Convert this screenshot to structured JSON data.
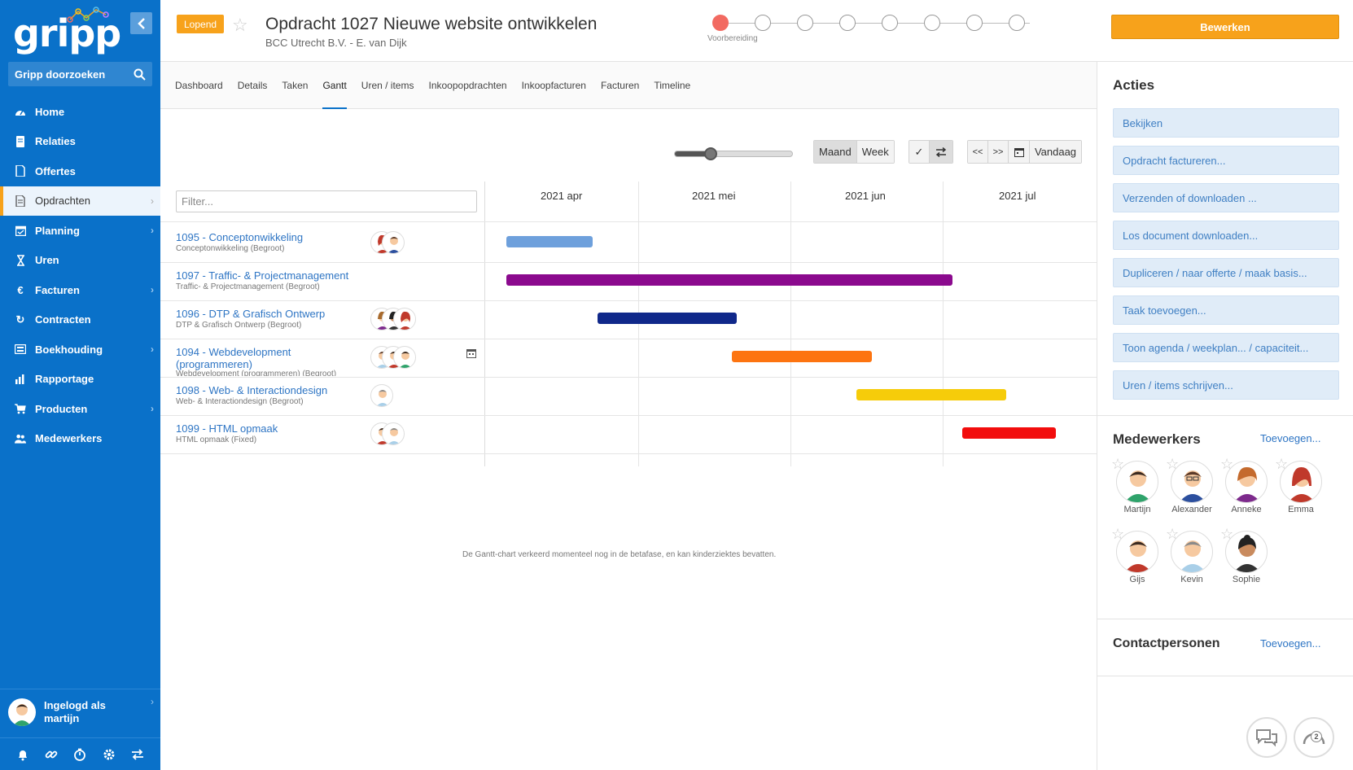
{
  "sidebar": {
    "logo": "gripp",
    "search_label": "Gripp doorzoeken",
    "items": [
      {
        "label": "Home",
        "icon": "gauge-icon"
      },
      {
        "label": "Relaties",
        "icon": "book-icon"
      },
      {
        "label": "Offertes",
        "icon": "document-icon"
      },
      {
        "label": "Opdrachten",
        "icon": "clipboard-icon"
      },
      {
        "label": "Planning",
        "icon": "calendar-icon"
      },
      {
        "label": "Uren",
        "icon": "hourglass-icon"
      },
      {
        "label": "Facturen",
        "icon": "euro-icon"
      },
      {
        "label": "Contracten",
        "icon": "refresh-icon"
      },
      {
        "label": "Boekhouding",
        "icon": "calculator-icon"
      },
      {
        "label": "Rapportage",
        "icon": "bar-chart-icon"
      },
      {
        "label": "Producten",
        "icon": "cart-icon"
      },
      {
        "label": "Medewerkers",
        "icon": "users-icon"
      }
    ],
    "user_line1": "Ingelogd als",
    "user_line2": "martijn"
  },
  "header": {
    "status": "Lopend",
    "title": "Opdracht 1027 Nieuwe website ontwikkelen",
    "subtitle": "BCC Utrecht B.V. - E. van Dijk",
    "step_label": "Voorbereiding",
    "edit_label": "Bewerken"
  },
  "tabs": [
    "Dashboard",
    "Details",
    "Taken",
    "Gantt",
    "Uren / items",
    "Inkoopopdrachten",
    "Inkoopfacturen",
    "Facturen",
    "Timeline"
  ],
  "toolbar": {
    "zoom_level": 0.3,
    "maand": "Maand",
    "week": "Week",
    "check": "✓",
    "prev": "<<",
    "next": ">>",
    "today": "Vandaag"
  },
  "gantt": {
    "filter_placeholder": "Filter...",
    "months": [
      "2021 apr",
      "2021 mei",
      "2021 jun",
      "2021 jul"
    ],
    "rows": [
      {
        "title": "1095 - Conceptonwikkeling",
        "sub": "Conceptonwikkeling (Begroot)",
        "color": "#6ea0dc",
        "start": "2021-04-05",
        "end": "2021-04-22"
      },
      {
        "title": "1097 - Traffic- & Projectmanagement",
        "sub": "Traffic- & Projectmanagement (Begroot)",
        "color": "#8b0a8e",
        "start": "2021-04-05",
        "end": "2021-07-03"
      },
      {
        "title": "1096 - DTP & Grafisch Ontwerp",
        "sub": "DTP & Grafisch Ontwerp (Begroot)",
        "color": "#10288a",
        "start": "2021-04-23",
        "end": "2021-05-21"
      },
      {
        "title": "1094 - Webdevelopment (programmeren)",
        "sub": "Webdevelopment (programmeren) (Begroot)",
        "color": "#fd7410",
        "start": "2021-05-20",
        "end": "2021-06-17"
      },
      {
        "title": "1098 - Web- & Interactiondesign",
        "sub": "Web- & Interactiondesign (Begroot)",
        "color": "#f6cc0a",
        "start": "2021-06-14",
        "end": "2021-07-14"
      },
      {
        "title": "1099 - HTML opmaak",
        "sub": "HTML opmaak (Fixed)",
        "color": "#f20d0d",
        "start": "2021-07-05",
        "end": "2021-07-24"
      }
    ],
    "beta_note": "De Gantt-chart verkeerd momenteel nog in de betafase, en kan kinderziektes bevatten."
  },
  "right_panel": {
    "acties_title": "Acties",
    "actions": [
      "Bekijken",
      "Opdracht factureren...",
      "Verzenden of downloaden ...",
      "Los document downloaden...",
      "Dupliceren / naar offerte / maak basis...",
      "Taak toevoegen...",
      "Toon agenda   / weekplan...    / capaciteit...",
      "Uren / items schrijven..."
    ],
    "medewerkers_title": "Medewerkers",
    "medewerkers_add": "Toevoegen...",
    "employees": [
      "Martijn",
      "Alexander",
      "Anneke",
      "Emma",
      "Gijs",
      "Kevin",
      "Sophie"
    ],
    "contact_title": "Contactpersonen",
    "contact_add": "Toevoegen...",
    "chat_badge": "2"
  }
}
